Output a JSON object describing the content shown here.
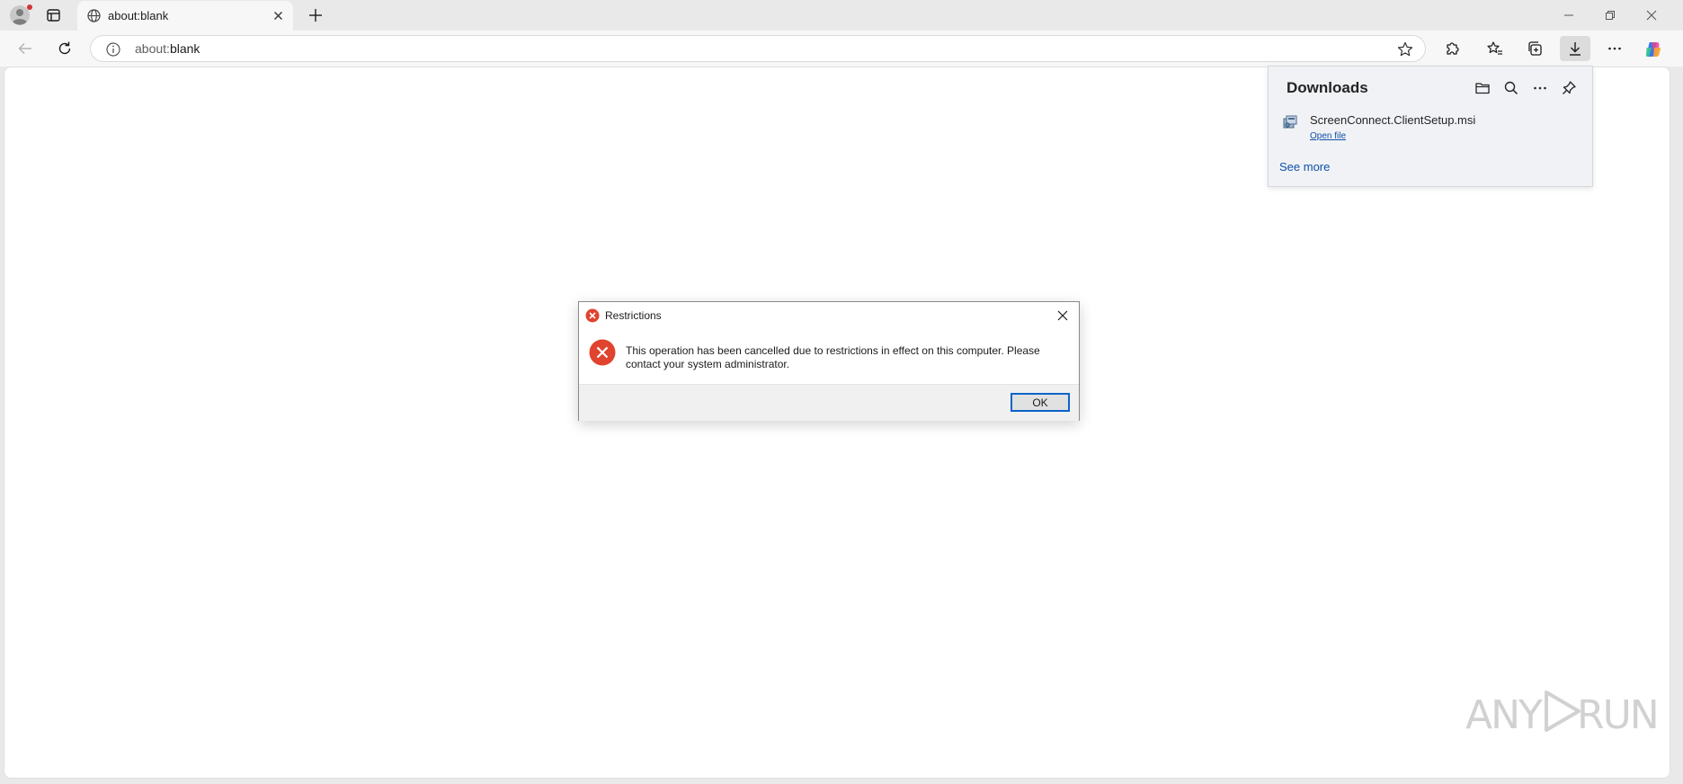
{
  "tab": {
    "title": "about:blank"
  },
  "address": {
    "scheme": "about:",
    "rest": "blank"
  },
  "downloads": {
    "heading": "Downloads",
    "item": {
      "filename": "ScreenConnect.ClientSetup.msi",
      "action": "Open file"
    },
    "see_more": "See more"
  },
  "dialog": {
    "title": "Restrictions",
    "message": "This operation has been cancelled due to restrictions in effect on this computer. Please contact your system administrator.",
    "ok_label": "OK"
  },
  "watermark": {
    "left": "ANY",
    "right": "RUN"
  },
  "colors": {
    "error_red": "#e0432e",
    "link_blue": "#0f4fa8",
    "focus_blue": "#0a64c8"
  }
}
